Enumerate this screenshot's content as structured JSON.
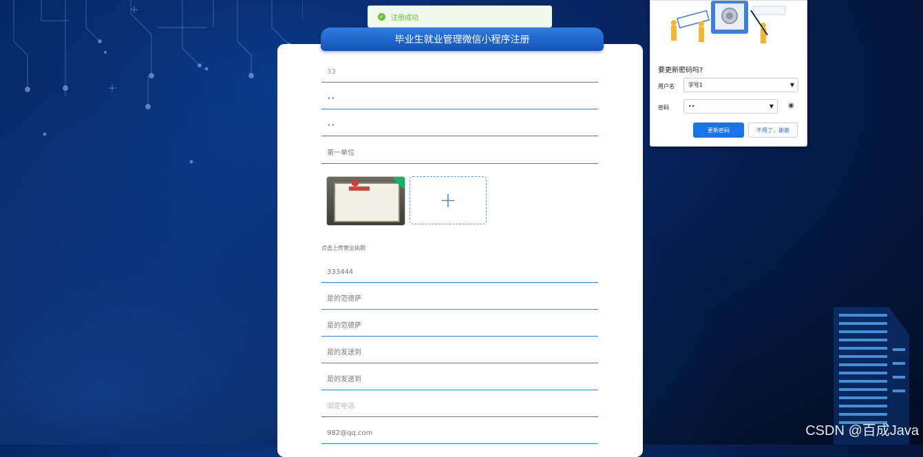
{
  "toast": {
    "icon": "check-circle-icon",
    "text": "注册成功"
  },
  "form": {
    "title": "毕业生就业管理微信小程序注册",
    "fields": [
      {
        "value": "33"
      },
      {
        "value": "••"
      },
      {
        "value": "••"
      },
      {
        "value": "第一单位"
      }
    ],
    "upload": {
      "hint": "点击上传营业执照",
      "add_icon": "+"
    },
    "fields2": [
      {
        "value": "333444"
      },
      {
        "value": "是的范德萨"
      },
      {
        "value": "是的范德萨"
      },
      {
        "value": "是的发送到"
      },
      {
        "value": "是的发送到"
      },
      {
        "placeholder": "固定电话"
      },
      {
        "value": "982@qq.com"
      }
    ]
  },
  "password_popup": {
    "title": "要更新密码吗?",
    "username_label": "用户名",
    "username_value": "学号1",
    "password_label": "密码",
    "password_value": "••",
    "update_button": "更新密码",
    "decline_button": "不用了，谢谢",
    "illustration_text": "****"
  },
  "watermark": "CSDN @百成Java",
  "colors": {
    "accent": "#1a73e8",
    "success": "#67c23a",
    "underline": "#3b82e8"
  }
}
